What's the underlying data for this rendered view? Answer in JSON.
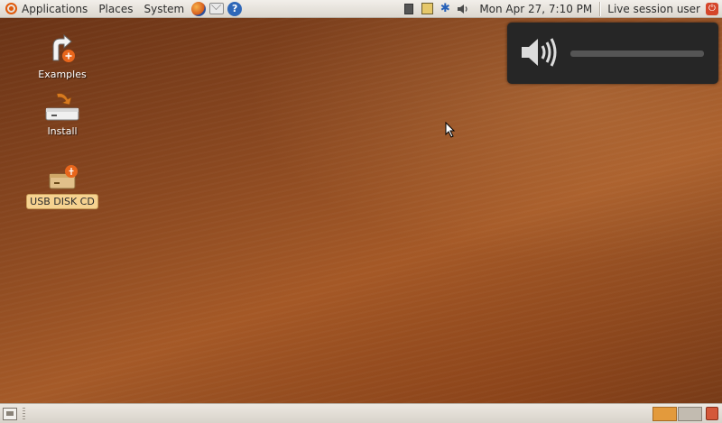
{
  "top_panel": {
    "menus": [
      "Applications",
      "Places",
      "System"
    ],
    "launchers": [
      "firefox-icon",
      "mail-icon",
      "help-icon"
    ],
    "help_glyph": "?",
    "bluetooth_glyph": "✱",
    "clock": "Mon Apr 27,  7:10 PM",
    "user": "Live session user",
    "power_glyph": "⏻"
  },
  "desktop": {
    "icons": [
      {
        "label": "Examples",
        "icon": "examples-icon",
        "selected": false
      },
      {
        "label": "Install",
        "icon": "install-icon",
        "selected": false
      },
      {
        "label": "USB DISK CD",
        "icon": "usb-disk-icon",
        "selected": true
      }
    ]
  },
  "volume_osd": {
    "icon": "speaker-icon",
    "level": 0.0
  },
  "bottom_panel": {
    "workspaces": [
      {
        "active": true
      },
      {
        "active": false
      }
    ]
  },
  "colors": {
    "accent": "#e05a0c",
    "selection": "#f6d290"
  }
}
